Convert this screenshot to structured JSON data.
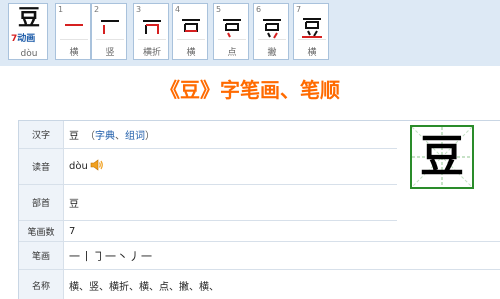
{
  "character": "豆",
  "stroke_count": "7",
  "animate_label": "动画",
  "pinyin": "dòu",
  "pinyin_display": "dòu",
  "strokes": [
    {
      "n": "1",
      "name": "横"
    },
    {
      "n": "2",
      "name": "竖"
    },
    {
      "n": "3",
      "name": "横折"
    },
    {
      "n": "4",
      "name": "横"
    },
    {
      "n": "5",
      "name": "点"
    },
    {
      "n": "6",
      "name": "撇"
    },
    {
      "n": "7",
      "name": "横"
    }
  ],
  "title": "《豆》字笔画、笔顺",
  "table": {
    "hanzi_label": "汉字",
    "hanzi_value": "豆",
    "paren_open": "（",
    "zidian_link": "字典",
    "sep": "、",
    "zuci_link": "组词",
    "paren_close": "）",
    "duyin_label": "读音",
    "bushou_label": "部首",
    "bushou_value": "豆",
    "bihuashu_label": "笔画数",
    "bihuashu_value": "7",
    "bihua_label": "笔画",
    "bihua_value": "一丨㇆一丶丿一",
    "mingcheng_label": "名称",
    "mingcheng_value": "横、竖、横折、横、点、撇、横、"
  },
  "colors": {
    "accent": "#ff6a00",
    "link": "#1a5aa8",
    "strip_bg": "#dde9f5",
    "current_stroke": "#d62020",
    "grid_green": "#2a8c2a"
  }
}
